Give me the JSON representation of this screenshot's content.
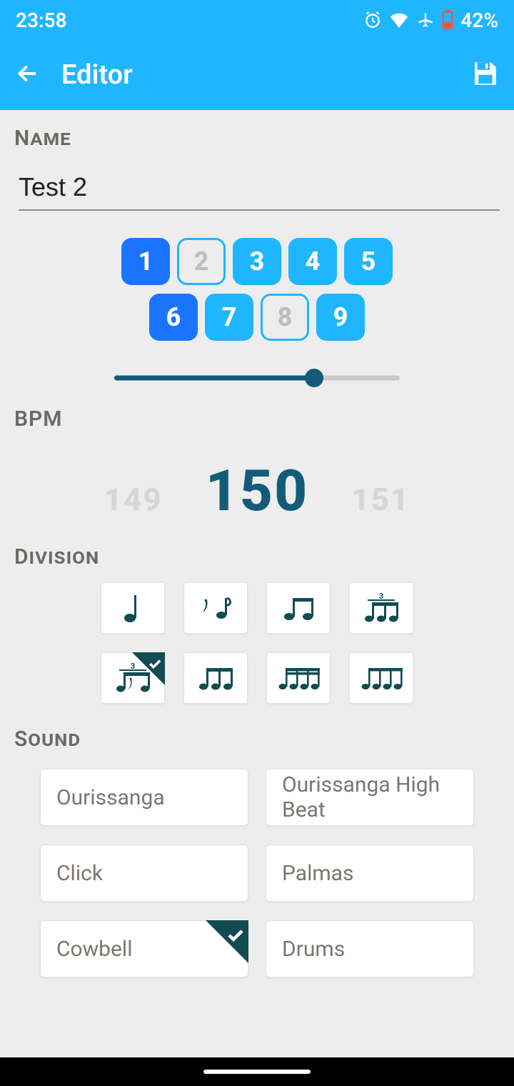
{
  "status": {
    "time": "23:58",
    "battery": "42%"
  },
  "appBar": {
    "title": "Editor"
  },
  "sections": {
    "name": "Name",
    "bpm": "BPM",
    "division": "Division",
    "sound": "Sound"
  },
  "nameValue": "Test 2",
  "beats": {
    "row1": [
      {
        "n": "1",
        "style": "dark"
      },
      {
        "n": "2",
        "style": "hollow"
      },
      {
        "n": "3",
        "style": "light"
      },
      {
        "n": "4",
        "style": "light"
      },
      {
        "n": "5",
        "style": "light"
      }
    ],
    "row2": [
      {
        "n": "6",
        "style": "dark"
      },
      {
        "n": "7",
        "style": "light"
      },
      {
        "n": "8",
        "style": "hollow"
      },
      {
        "n": "9",
        "style": "light"
      }
    ]
  },
  "slider": {
    "percent": 70
  },
  "bpm": {
    "prev": "149",
    "current": "150",
    "next": "151"
  },
  "division": {
    "items": [
      {
        "icon": "quarter"
      },
      {
        "icon": "rest-eighth"
      },
      {
        "icon": "two-eighths"
      },
      {
        "icon": "triplet"
      },
      {
        "icon": "swing-triplet",
        "selected": true
      },
      {
        "icon": "three-eighths"
      },
      {
        "icon": "four-sixteenths-a"
      },
      {
        "icon": "four-sixteenths-b"
      }
    ]
  },
  "sounds": [
    {
      "label": "Ourissanga"
    },
    {
      "label": "Ourissanga High Beat"
    },
    {
      "label": "Click"
    },
    {
      "label": "Palmas"
    },
    {
      "label": "Cowbell",
      "selected": true
    },
    {
      "label": "Drums"
    }
  ]
}
